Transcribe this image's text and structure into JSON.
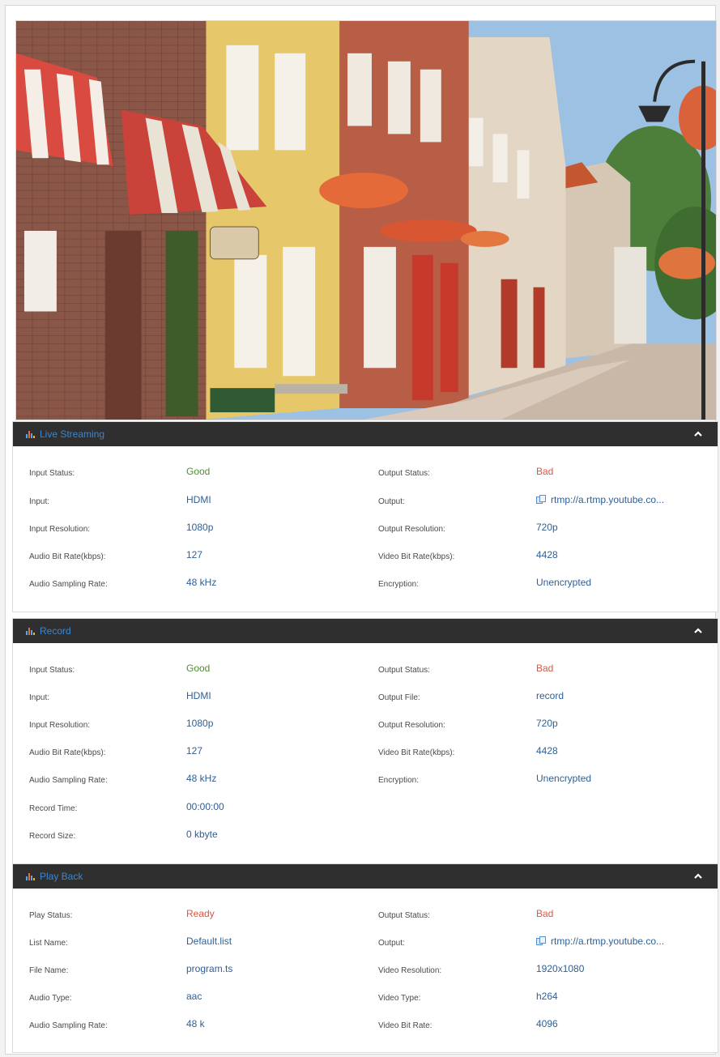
{
  "panels": {
    "live": {
      "title": "Live Streaming",
      "rows": [
        {
          "l_label": "Input Status:",
          "l_value": "Good",
          "r_label": "Output Status:",
          "r_value": "Bad"
        },
        {
          "l_label": "Input:",
          "l_value": "HDMI",
          "r_label": "Output:",
          "r_value": "rtmp://a.rtmp.youtube.co..."
        },
        {
          "l_label": "Input Resolution:",
          "l_value": "1080p",
          "r_label": "Output Resolution:",
          "r_value": "720p"
        },
        {
          "l_label": "Audio Bit Rate(kbps):",
          "l_value": "127",
          "r_label": "Video Bit Rate(kbps):",
          "r_value": "4428"
        },
        {
          "l_label": "Audio Sampling Rate:",
          "l_value": "48 kHz",
          "r_label": "Encryption:",
          "r_value": "Unencrypted"
        }
      ]
    },
    "record": {
      "title": "Record",
      "rows": [
        {
          "l_label": "Input Status:",
          "l_value": "Good",
          "r_label": "Output Status:",
          "r_value": "Bad"
        },
        {
          "l_label": "Input:",
          "l_value": "HDMI",
          "r_label": "Output File:",
          "r_value": "record"
        },
        {
          "l_label": "Input Resolution:",
          "l_value": "1080p",
          "r_label": "Output Resolution:",
          "r_value": "720p"
        },
        {
          "l_label": "Audio Bit Rate(kbps):",
          "l_value": "127",
          "r_label": "Video Bit Rate(kbps):",
          "r_value": "4428"
        },
        {
          "l_label": "Audio Sampling Rate:",
          "l_value": "48 kHz",
          "r_label": "Encryption:",
          "r_value": "Unencrypted"
        },
        {
          "l_label": "Record Time:",
          "l_value": "00:00:00"
        },
        {
          "l_label": "Record Size:",
          "l_value": "0 kbyte"
        }
      ]
    },
    "playback": {
      "title": "Play Back",
      "rows": [
        {
          "l_label": "Play Status:",
          "l_value": "Ready",
          "r_label": "Output Status:",
          "r_value": "Bad"
        },
        {
          "l_label": "List Name:",
          "l_value": "Default.list",
          "r_label": "Output:",
          "r_value": "rtmp://a.rtmp.youtube.co..."
        },
        {
          "l_label": "File Name:",
          "l_value": "program.ts",
          "r_label": "Video Resolution:",
          "r_value": "1920x1080"
        },
        {
          "l_label": "Audio Type:",
          "l_value": "aac",
          "r_label": "Video Type:",
          "r_value": "h264"
        },
        {
          "l_label": "Audio Sampling Rate:",
          "l_value": "48 k",
          "r_label": "Video Bit Rate:",
          "r_value": "4096"
        }
      ]
    }
  },
  "icons": {
    "panel_icon": "bar-chart-icon",
    "collapse": "chevron-up-icon",
    "link": "copy-link-icon"
  },
  "colors": {
    "good": "#4f8f2f",
    "bad": "#e0553c",
    "value": "#2f5f96",
    "header_bg": "#2f2f2f",
    "header_title": "#3b86d1"
  }
}
